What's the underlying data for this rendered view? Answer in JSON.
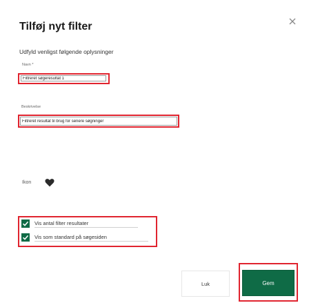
{
  "dialog": {
    "title": "Tilføj nyt filter",
    "subtitle": "Udfyld venligst følgende oplysninger"
  },
  "fields": {
    "name": {
      "label": "Navn *",
      "value": "Filtreret søgeresultat 1"
    },
    "description": {
      "label": "Beskrivelse",
      "value": "Filtreret resultat til brug for senere søgninger"
    }
  },
  "icon": {
    "label": "Ikon",
    "name": "heart-icon",
    "color": "#2b2b2b"
  },
  "options": [
    {
      "label": "Vis antal filter resultater",
      "checked": true
    },
    {
      "label": "Vis som standard på søgesiden",
      "checked": true
    }
  ],
  "buttons": {
    "close_label": "Luk",
    "save_label": "Gem"
  },
  "colors": {
    "primary": "#0f6b46",
    "highlight": "#e0232e"
  }
}
